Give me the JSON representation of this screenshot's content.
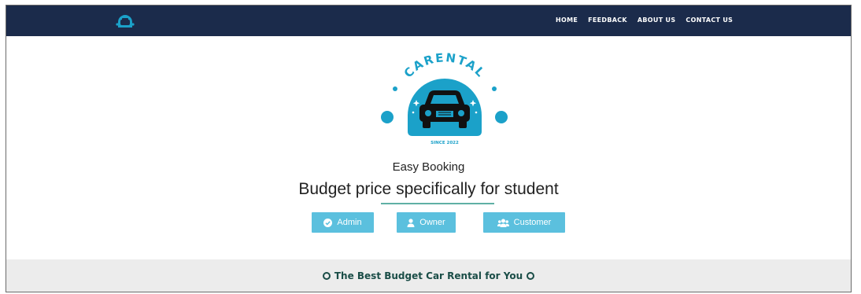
{
  "navbar": {
    "links": [
      "HOME",
      "FEEDBACK",
      "ABOUT US",
      "CONTACT US"
    ]
  },
  "logo": {
    "brand": "CARENTAL",
    "since": "SINCE 2022"
  },
  "hero": {
    "tagline": "Easy Booking",
    "headline": "Budget price specifically for student"
  },
  "buttons": {
    "admin": "Admin",
    "owner": "Owner",
    "customer": "Customer"
  },
  "footer": {
    "text": "The Best Budget Car Rental for You"
  },
  "colors": {
    "navbar": "#1b2b4b",
    "accent": "#1ba1c9",
    "button": "#5bc0de",
    "footer_text": "#1a4d47"
  }
}
